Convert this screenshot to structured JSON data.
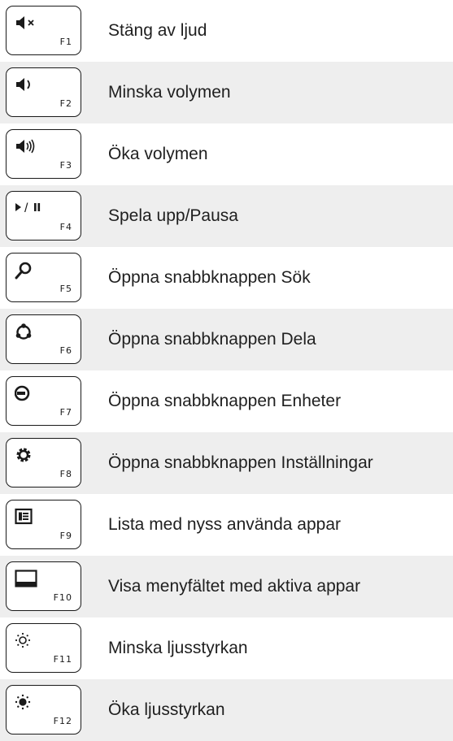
{
  "rows": [
    {
      "key": "F1",
      "icon": "mute-icon",
      "label": "Stäng av ljud"
    },
    {
      "key": "F2",
      "icon": "volume-down-icon",
      "label": "Minska volymen"
    },
    {
      "key": "F3",
      "icon": "volume-up-icon",
      "label": "Öka volymen"
    },
    {
      "key": "F4",
      "icon": "play-pause-icon",
      "label": "Spela upp/Pausa"
    },
    {
      "key": "F5",
      "icon": "search-icon",
      "label": "Öppna snabbknappen Sök"
    },
    {
      "key": "F6",
      "icon": "share-icon",
      "label": "Öppna snabbknappen Dela"
    },
    {
      "key": "F7",
      "icon": "devices-icon",
      "label": "Öppna snabbknappen Enheter"
    },
    {
      "key": "F8",
      "icon": "gear-icon",
      "label": "Öppna snabbknappen Inställningar"
    },
    {
      "key": "F9",
      "icon": "recent-apps-icon",
      "label": "Lista med nyss använda appar"
    },
    {
      "key": "F10",
      "icon": "app-bar-icon",
      "label": "Visa menyfältet med aktiva appar"
    },
    {
      "key": "F11",
      "icon": "brightness-down-icon",
      "label": "Minska ljusstyrkan"
    },
    {
      "key": "F12",
      "icon": "brightness-up-icon",
      "label": "Öka ljusstyrkan"
    }
  ],
  "play_pause_separator": "/"
}
